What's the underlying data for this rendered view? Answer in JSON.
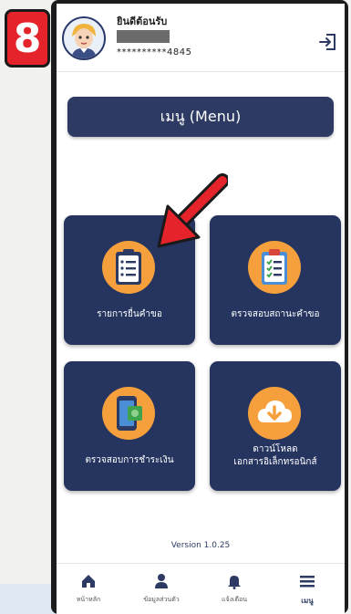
{
  "step_number": "8",
  "header": {
    "welcome": "ยินดีต้อนรับ",
    "user_id": "**********4845"
  },
  "menu_button": "เมนู (Menu)",
  "cards": [
    {
      "label": "รายการยื่นคำขอ",
      "icon": "clipboard-list-icon"
    },
    {
      "label": "ตรวจสอบสถานะคำขอ",
      "icon": "clipboard-check-icon"
    },
    {
      "label": "ตรวจสอบการชำระเงิน",
      "icon": "payment-phone-icon"
    },
    {
      "label": "ดาวน์โหลด\nเอกสารอิเล็กทรอนิกส์",
      "icon": "cloud-download-icon"
    }
  ],
  "version": "Version 1.0.25",
  "bottom_nav": [
    {
      "label": "หน้าหลัก",
      "icon": "home-icon"
    },
    {
      "label": "ข้อมูลส่วนตัว",
      "icon": "user-icon"
    },
    {
      "label": "แจ้งเตือน",
      "icon": "bell-icon"
    },
    {
      "label": "เมนู",
      "icon": "menu-icon"
    }
  ],
  "colors": {
    "primary": "#2d3a63",
    "card": "#263560",
    "icon_circle": "#f5a03c",
    "arrow": "#e5232b"
  }
}
